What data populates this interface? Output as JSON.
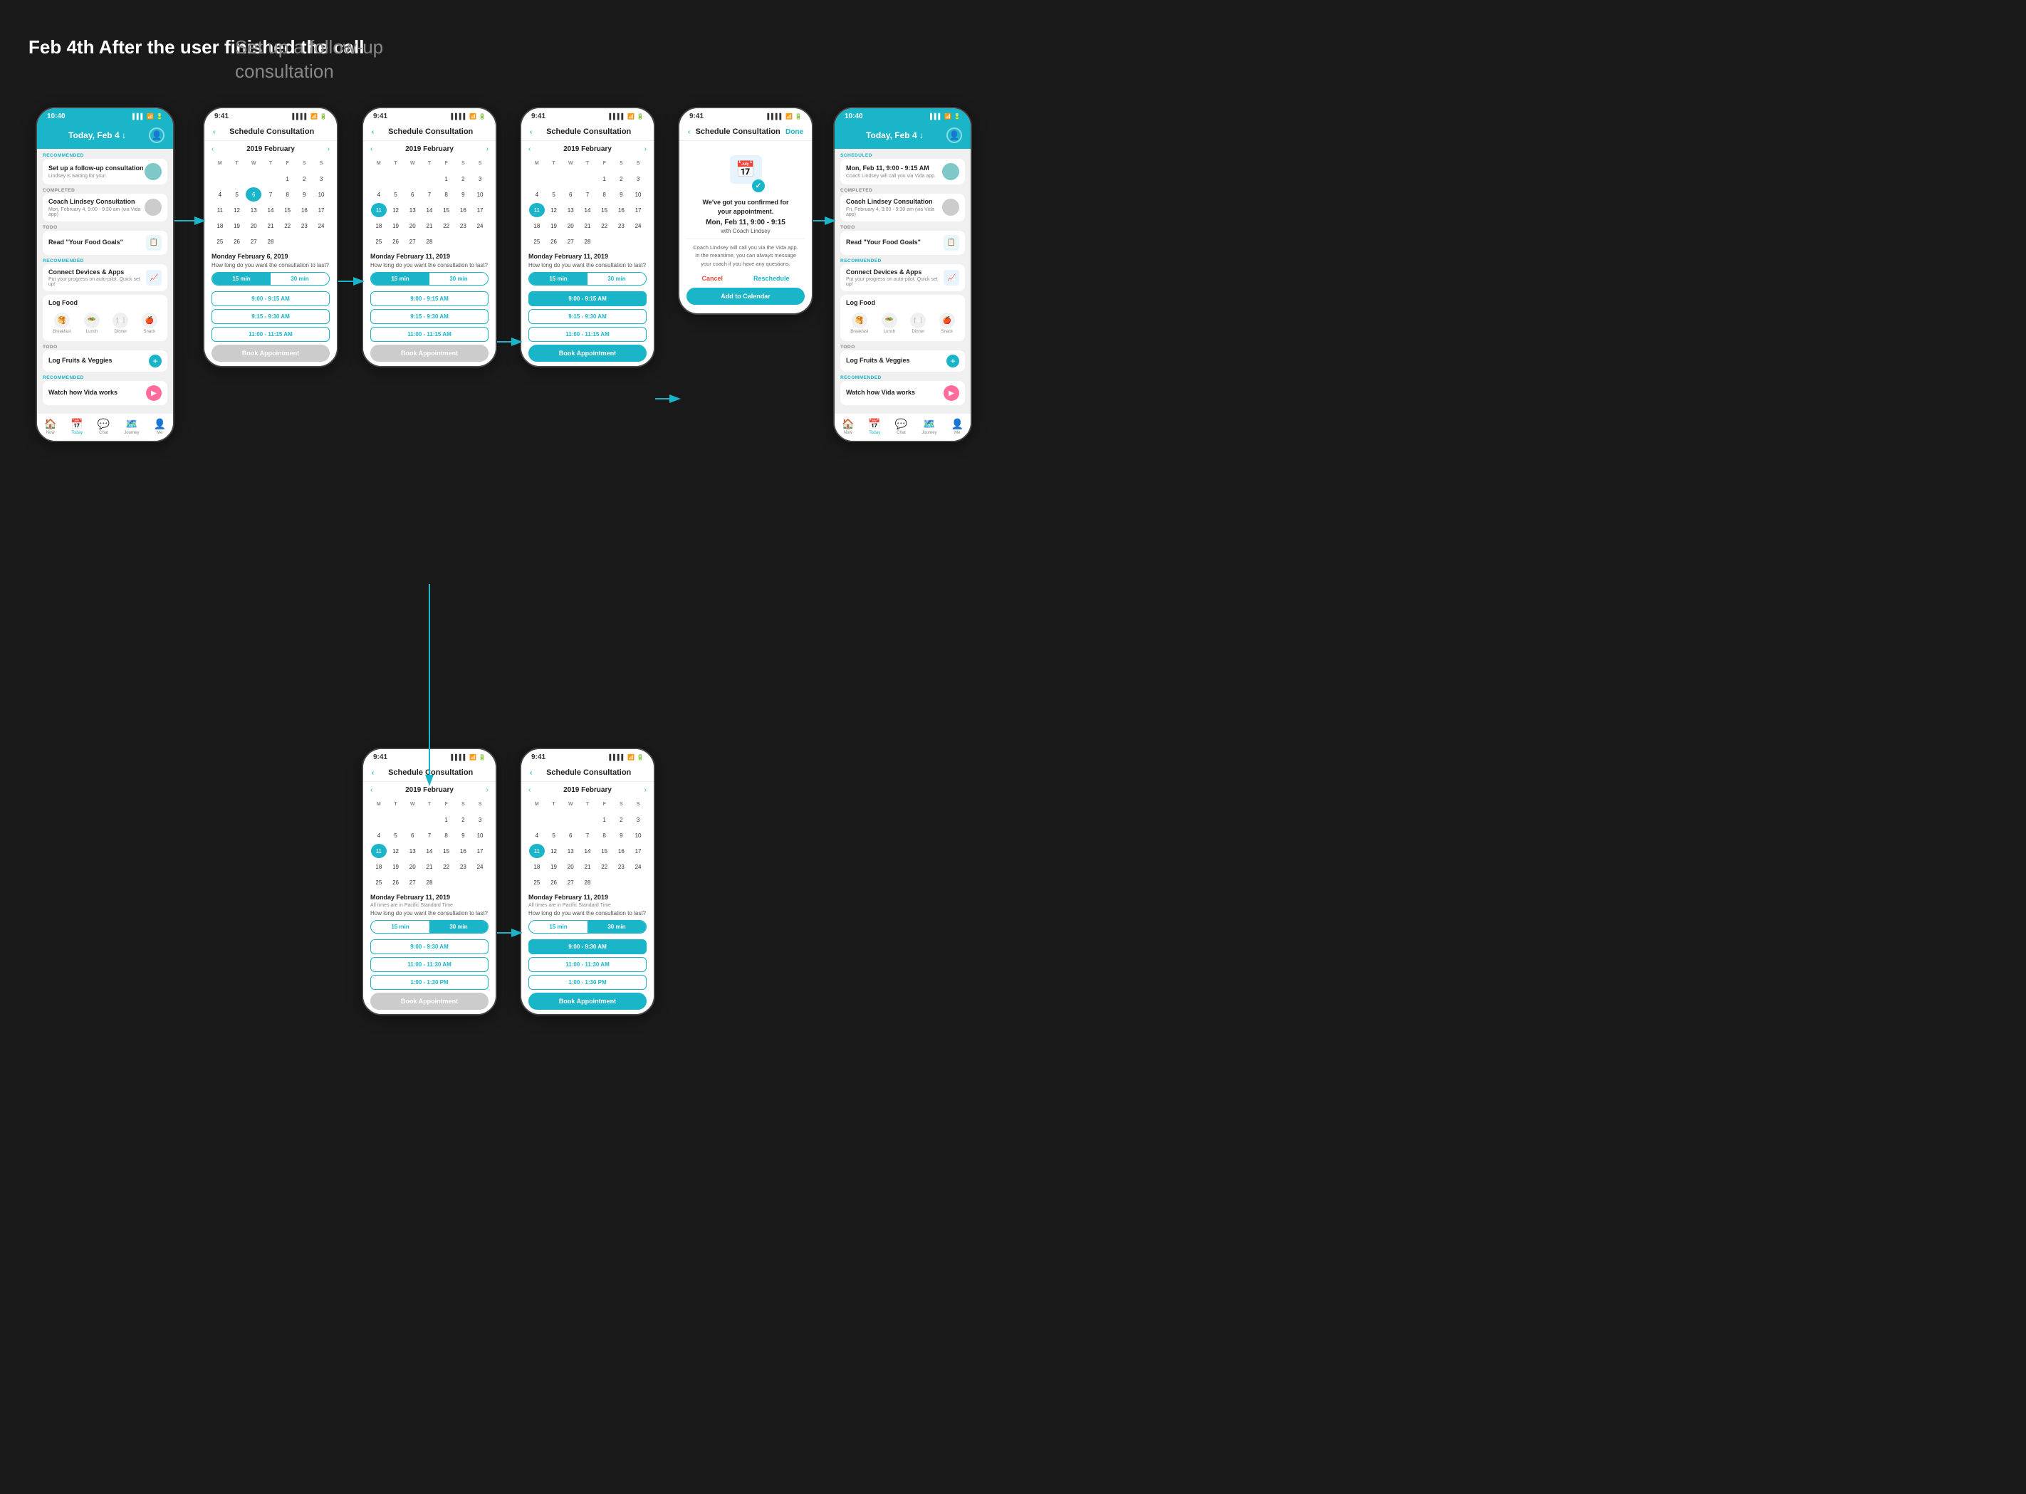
{
  "page": {
    "background": "#1a1a1a",
    "section_label_left": "Feb 4th\nAfter the user\nfinished the call",
    "section_label_right": "Set up a follow-up\nconsultation"
  },
  "phones": {
    "phone1": {
      "time": "10:40",
      "header": "Today, Feb 4 ↓",
      "type": "today_first",
      "items": [
        {
          "tag": "RECOMMENDED",
          "title": "Set up a follow-up consultation",
          "sub": "Lindsey is waiting for you!"
        },
        {
          "tag": "COMPLETED",
          "title": "Coach Lindsey Consultation",
          "sub": "Mon, February 4, 9:00 - 9:30 am (via Vida app)"
        },
        {
          "tag": "TODO",
          "title": "Read \"Your Food Goals\"",
          "sub": ""
        },
        {
          "tag": "RECOMMENDED",
          "title": "Connect Devices & Apps",
          "sub": "Put your progress on auto-pilot. Quick set up!"
        },
        {
          "tag": "",
          "title": "Log Food",
          "sub": ""
        },
        {
          "tag": "TODO",
          "title": "Log Fruits & Veggies",
          "sub": ""
        },
        {
          "tag": "RECOMMENDED",
          "title": "Watch how Vida works",
          "sub": ""
        }
      ],
      "nav": [
        "Now",
        "Today",
        "Chat",
        "Journey",
        "Me"
      ]
    },
    "phone2": {
      "time": "9:41",
      "header": "Schedule Consultation",
      "type": "calendar",
      "month": "2019 February",
      "selected_day": "6",
      "date_label": "Monday February 6, 2019",
      "duration_question": "How long do you want the consultation to last?",
      "active_duration": "15 min",
      "inactive_duration": "30 min",
      "slots": [
        "9:00 - 9:15 AM",
        "9:15 - 9:30 AM",
        "11:00 - 11:15 AM"
      ],
      "book_btn": "Book Appointment",
      "book_active": false
    },
    "phone3": {
      "time": "9:41",
      "header": "Schedule Consultation",
      "type": "calendar",
      "month": "2019 February",
      "selected_day": "11",
      "date_label": "Monday February 11, 2019",
      "duration_question": "How long do you want the consultation to last?",
      "active_duration": "15 min",
      "inactive_duration": "30 min",
      "slots": [
        "9:00 - 9:15 AM",
        "9:15 - 9:30 AM",
        "11:00 - 11:15 AM"
      ],
      "book_btn": "Book Appointment",
      "book_active": false
    },
    "phone4": {
      "time": "9:41",
      "header": "Schedule Consultation",
      "type": "calendar_selected",
      "month": "2019 February",
      "selected_day": "11",
      "date_label": "Monday February 11, 2019",
      "duration_question": "How long do you want the consultation to last?",
      "active_duration": "15 min",
      "inactive_duration": "30 min",
      "slots": [
        "9:00 - 9:15 AM",
        "9:15 - 9:30 AM",
        "11:00 - 11:15 AM"
      ],
      "selected_slot": "9:00 - 9:15 AM",
      "book_btn": "Book Appointment",
      "book_active": true
    },
    "phone5": {
      "time": "9:41",
      "header": "Schedule Consultation",
      "type": "confirmation",
      "done_label": "Done",
      "confirm_title": "We've got you confirmed for your appointment.",
      "confirm_date": "Mon, Feb 11, 9:00 - 9:15",
      "confirm_with": "with Coach Lindsey",
      "confirm_sub": "Coach Lindsey will call you via the Vida app.\nIn the meantime, you can always message\nyour coach if you have any questions.",
      "cancel_label": "Cancel",
      "reschedule_label": "Reschedule",
      "add_cal_label": "Add to Calendar"
    },
    "phone6": {
      "time": "10:40",
      "header": "Today, Feb 4 ↓",
      "type": "today_updated",
      "items": [
        {
          "tag": "SCHEDULED",
          "title": "Mon, Feb 11, 9:00 - 9:15 AM",
          "sub": "Coach Lindsey will call you via Vida app."
        },
        {
          "tag": "COMPLETED",
          "title": "Coach Lindsey Consultation",
          "sub": "Fri, February 4, 9:00 - 9:30 am (via Vida app)"
        },
        {
          "tag": "TODO",
          "title": "Read \"Your Food Goals\"",
          "sub": ""
        },
        {
          "tag": "RECOMMENDED",
          "title": "Connect Devices & Apps",
          "sub": "Put your progress on auto-pilot. Quick set up!"
        },
        {
          "tag": "",
          "title": "Log Food",
          "sub": ""
        },
        {
          "tag": "TODO",
          "title": "Log Fruits & Veggies",
          "sub": ""
        },
        {
          "tag": "RECOMMENDED",
          "title": "Watch how Vida works",
          "sub": ""
        }
      ],
      "nav": [
        "Now",
        "Today",
        "Chat",
        "Journey",
        "Me"
      ]
    },
    "phone7": {
      "time": "9:41",
      "header": "Schedule Consultation",
      "type": "calendar_30min",
      "month": "2019 February",
      "selected_day": "11",
      "date_label": "Monday February 11, 2019",
      "duration_question": "How long do you want the consultation to last?",
      "active_duration": "30 min",
      "inactive_duration": "15 min",
      "slots": [
        "9:00 - 9:30 AM",
        "11:00 - 11:30 AM",
        "1:00 - 1:30 PM"
      ],
      "book_btn": "Book Appointment",
      "book_active": false
    },
    "phone8": {
      "time": "9:41",
      "header": "Schedule Consultation",
      "type": "calendar_30min_selected",
      "month": "2019 February",
      "selected_day": "11",
      "date_label": "Monday February 11, 2019",
      "duration_question": "How long do you want the consultation to last?",
      "active_duration": "30 min",
      "inactive_duration": "15 min",
      "slots": [
        "9:00 - 9:30 AM",
        "11:00 - 11:30 AM",
        "1:00 - 1:30 PM"
      ],
      "selected_slot": "9:00 - 9:30 AM",
      "book_btn": "Book Appointment",
      "book_active": true
    }
  },
  "calendar": {
    "headers": [
      "M",
      "T",
      "W",
      "T",
      "F",
      "S",
      "S"
    ],
    "weeks_feb_2019": [
      [
        "",
        "",
        "",
        "",
        "1",
        "2",
        "3"
      ],
      [
        "4",
        "5",
        "6",
        "7",
        "8",
        "9",
        "10"
      ],
      [
        "11",
        "12",
        "13",
        "14",
        "15",
        "16",
        "17"
      ],
      [
        "18",
        "19",
        "20",
        "21",
        "22",
        "23",
        "24"
      ],
      [
        "25",
        "26",
        "27",
        "28",
        "",
        "",
        ""
      ]
    ]
  }
}
